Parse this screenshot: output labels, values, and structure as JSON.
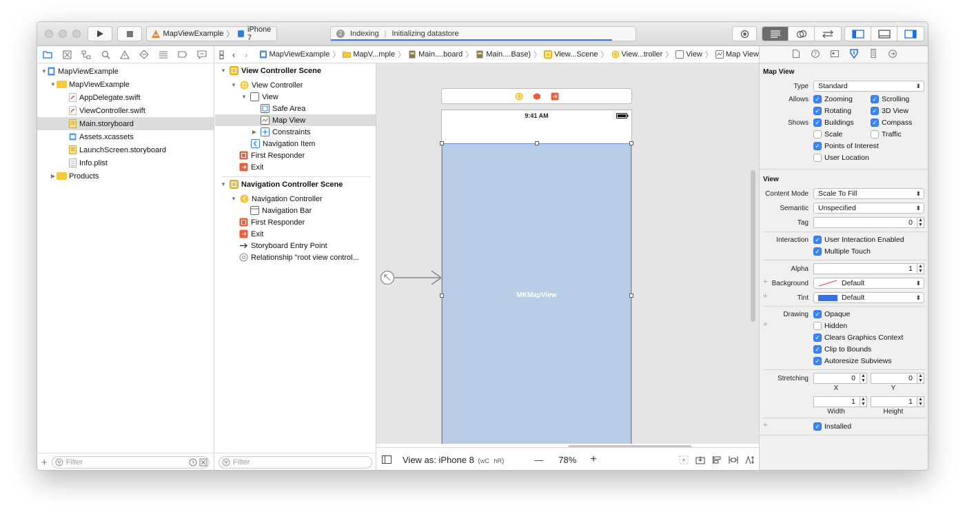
{
  "toolbar": {
    "scheme_project": "MapViewExample",
    "scheme_device": "iPhone 7",
    "activity_task": "Indexing",
    "activity_status": "Initializing datastore"
  },
  "navigator": {
    "items": [
      {
        "label": "MapViewExample",
        "type": "project"
      },
      {
        "label": "MapViewExample",
        "type": "folder"
      },
      {
        "label": "AppDelegate.swift",
        "type": "swift"
      },
      {
        "label": "ViewController.swift",
        "type": "swift"
      },
      {
        "label": "Main.storyboard",
        "type": "storyboard"
      },
      {
        "label": "Assets.xcassets",
        "type": "assets"
      },
      {
        "label": "LaunchScreen.storyboard",
        "type": "storyboard"
      },
      {
        "label": "Info.plist",
        "type": "plist"
      },
      {
        "label": "Products",
        "type": "folder"
      }
    ],
    "filter_placeholder": "Filter"
  },
  "jumpbar": {
    "crumbs": [
      "MapViewExample",
      "MapV...mple",
      "Main....board",
      "Main....Base)",
      "View...Scene",
      "View...troller",
      "View",
      "Map View"
    ]
  },
  "outline": {
    "items": [
      "View Controller Scene",
      "View Controller",
      "View",
      "Safe Area",
      "Map View",
      "Constraints",
      "Navigation Item",
      "First Responder",
      "Exit",
      "Navigation Controller Scene",
      "Navigation Controller",
      "Navigation Bar",
      "First Responder",
      "Exit",
      "Storyboard Entry Point",
      "Relationship \"root view control..."
    ],
    "filter_placeholder": "Filter"
  },
  "canvas": {
    "status_time": "9:41 AM",
    "map_label": "MKMapView",
    "view_as": "View as: iPhone 8",
    "size_class_w": "wC",
    "size_class_h": "hR",
    "zoom_minus": "—",
    "zoom": "78%",
    "zoom_plus": "+"
  },
  "inspector": {
    "mapview_title": "Map View",
    "type_label": "Type",
    "type_value": "Standard",
    "allows_label": "Allows",
    "shows_label": "Shows",
    "zooming": "Zooming",
    "scrolling": "Scrolling",
    "rotating": "Rotating",
    "view3d": "3D View",
    "buildings": "Buildings",
    "compass": "Compass",
    "scale": "Scale",
    "traffic": "Traffic",
    "poi": "Points of Interest",
    "user_location": "User Location",
    "view_title": "View",
    "content_mode_label": "Content Mode",
    "content_mode_value": "Scale To Fill",
    "semantic_label": "Semantic",
    "semantic_value": "Unspecified",
    "tag_label": "Tag",
    "tag_value": "0",
    "interaction_label": "Interaction",
    "user_interaction": "User Interaction Enabled",
    "multiple_touch": "Multiple Touch",
    "alpha_label": "Alpha",
    "alpha_value": "1",
    "background_label": "Background",
    "background_value": "Default",
    "tint_label": "Tint",
    "tint_value": "Default",
    "drawing_label": "Drawing",
    "opaque": "Opaque",
    "hidden": "Hidden",
    "clears_graphics": "Clears Graphics Context",
    "clip_bounds": "Clip to Bounds",
    "autoresize": "Autoresize Subviews",
    "stretching_label": "Stretching",
    "stretch_x": "0",
    "stretch_y": "0",
    "x_label": "X",
    "y_label": "Y",
    "stretch_w": "1",
    "stretch_h": "1",
    "width_label": "Width",
    "height_label": "Height",
    "installed": "Installed",
    "tint_color": "#3a6fe0",
    "accent_color": "#3b86f5"
  }
}
